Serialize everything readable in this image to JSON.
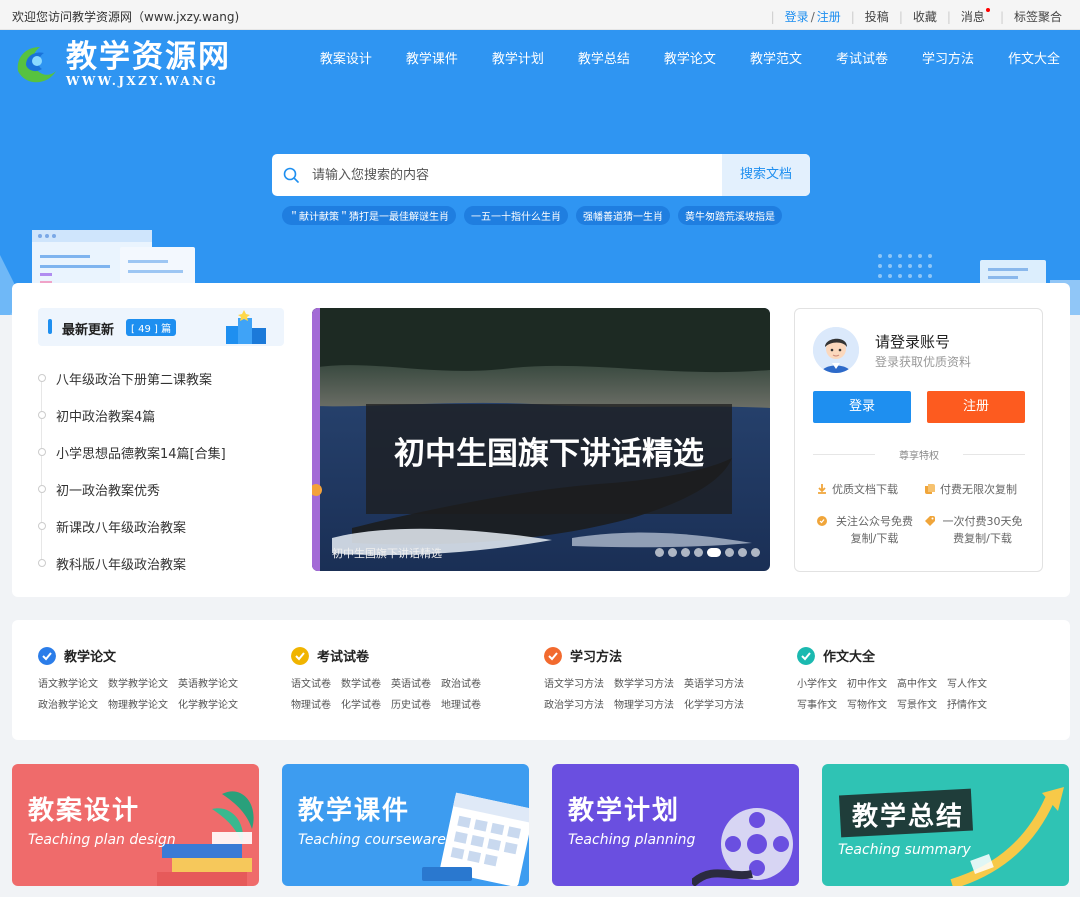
{
  "topbar": {
    "welcome": "欢迎您访问教学资源网（www.jxzy.wang)",
    "login": "登录",
    "slash": "/",
    "register": "注册",
    "links": [
      "投稿",
      "收藏",
      "消息",
      "标签聚合"
    ]
  },
  "logo": {
    "cn": "教学资源网",
    "en": "WWW.JXZY.WANG"
  },
  "nav": [
    "教案设计",
    "教学课件",
    "教学计划",
    "教学总结",
    "教学论文",
    "教学范文",
    "考试试卷",
    "学习方法",
    "作文大全"
  ],
  "search": {
    "placeholder": "请输入您搜索的内容",
    "button": "搜索文档",
    "tags": [
      "＂献计献策＂猜打是一最佳解谜生肖",
      "一五一十指什么生肖",
      "强幡善道猜一生肖",
      "黄牛匆踏荒溪坡指是"
    ]
  },
  "latest": {
    "title": "最新更新",
    "count": "[ 49 ] 篇",
    "items": [
      "八年级政治下册第二课教案",
      "初中政治教案4篇",
      "小学思想品德教案14篇[合集]",
      "初一政治教案优秀",
      "新课改八年级政治教案",
      "教科版八年级政治教案"
    ]
  },
  "banner": {
    "caption": "初中生国旗下讲话精选",
    "subcaption": "初中生国旗下讲话精选",
    "slides": 8,
    "active_slide": 5
  },
  "login": {
    "title": "请登录账号",
    "subtitle": "登录获取优质资料",
    "login_button": "登录",
    "register_button": "注册",
    "privilege_title": "尊享特权",
    "features": [
      "优质文档下载",
      "付费无限次复制",
      "关注公众号免费复制/下载",
      "一次付费30天免费复制/下载"
    ]
  },
  "categories": [
    {
      "title": "教学论文",
      "color": "#2b7de9",
      "links": [
        "语文教学论文",
        "数学教学论文",
        "英语教学论文",
        "政治教学论文",
        "物理教学论文",
        "化学教学论文"
      ]
    },
    {
      "title": "考试试卷",
      "color": "#f0b400",
      "links": [
        "语文试卷",
        "数学试卷",
        "英语试卷",
        "政治试卷",
        "物理试卷",
        "化学试卷",
        "历史试卷",
        "地理试卷"
      ]
    },
    {
      "title": "学习方法",
      "color": "#f26a2e",
      "links": [
        "语文学习方法",
        "数学学习方法",
        "英语学习方法",
        "政治学习方法",
        "物理学习方法",
        "化学学习方法"
      ]
    },
    {
      "title": "作文大全",
      "color": "#1bb9b0",
      "links": [
        "小学作文",
        "初中作文",
        "高中作文",
        "写人作文",
        "写事作文",
        "写物作文",
        "写景作文",
        "抒情作文"
      ]
    }
  ],
  "tiles": [
    {
      "cn": "教案设计",
      "en": "Teaching plan design",
      "color": "#ef6b6b"
    },
    {
      "cn": "教学课件",
      "en": "Teaching courseware",
      "color": "#3d9cf0"
    },
    {
      "cn": "教学计划",
      "en": "Teaching planning",
      "color": "#6a4fe0"
    },
    {
      "cn": "教学总结",
      "en": "Teaching summary",
      "color": "#2fc3b4"
    }
  ]
}
